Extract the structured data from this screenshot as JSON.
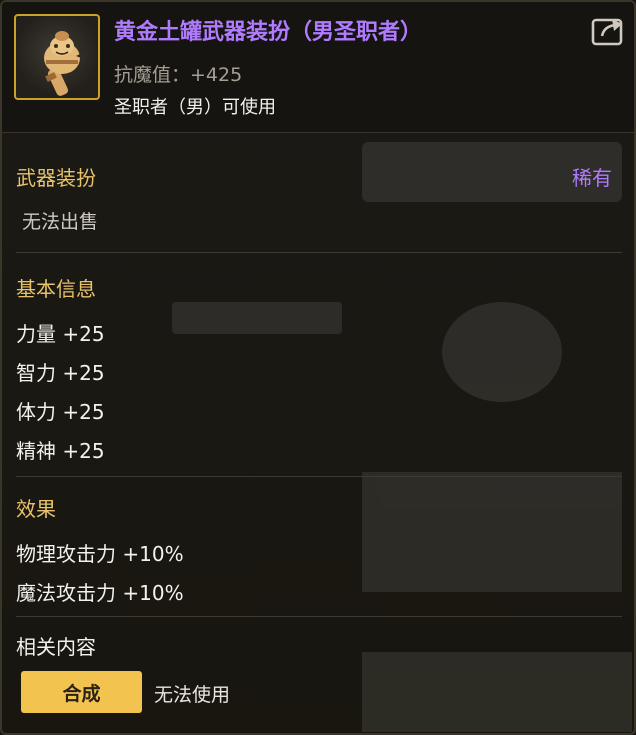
{
  "item": {
    "name": "黄金土罐武器装扮（男圣职者）",
    "stat_line": "抗魔值：+425",
    "requirement": "圣职者（男）可使用",
    "icon": "golden-clay-pot-weapon-icon",
    "title_color": "#b07bff"
  },
  "header": {
    "share_icon": "share-export-icon"
  },
  "category": {
    "label": "武器装扮",
    "rarity": "稀有",
    "sell_status": "无法出售"
  },
  "basic_info": {
    "label": "基本信息",
    "stats": [
      "力量 +25",
      "智力 +25",
      "体力 +25",
      "精神 +25"
    ]
  },
  "effects": {
    "label": "效果",
    "lines": [
      "物理攻击力 +10%",
      "魔法攻击力 +10%"
    ]
  },
  "related": {
    "label": "相关内容",
    "synth_button": "合成",
    "synth_status": "无法使用"
  },
  "colors": {
    "accent_gold": "#e8c36a",
    "rarity_purple": "#b07bff",
    "button_yellow": "#f2c34f",
    "icon_border": "#c9a227"
  }
}
